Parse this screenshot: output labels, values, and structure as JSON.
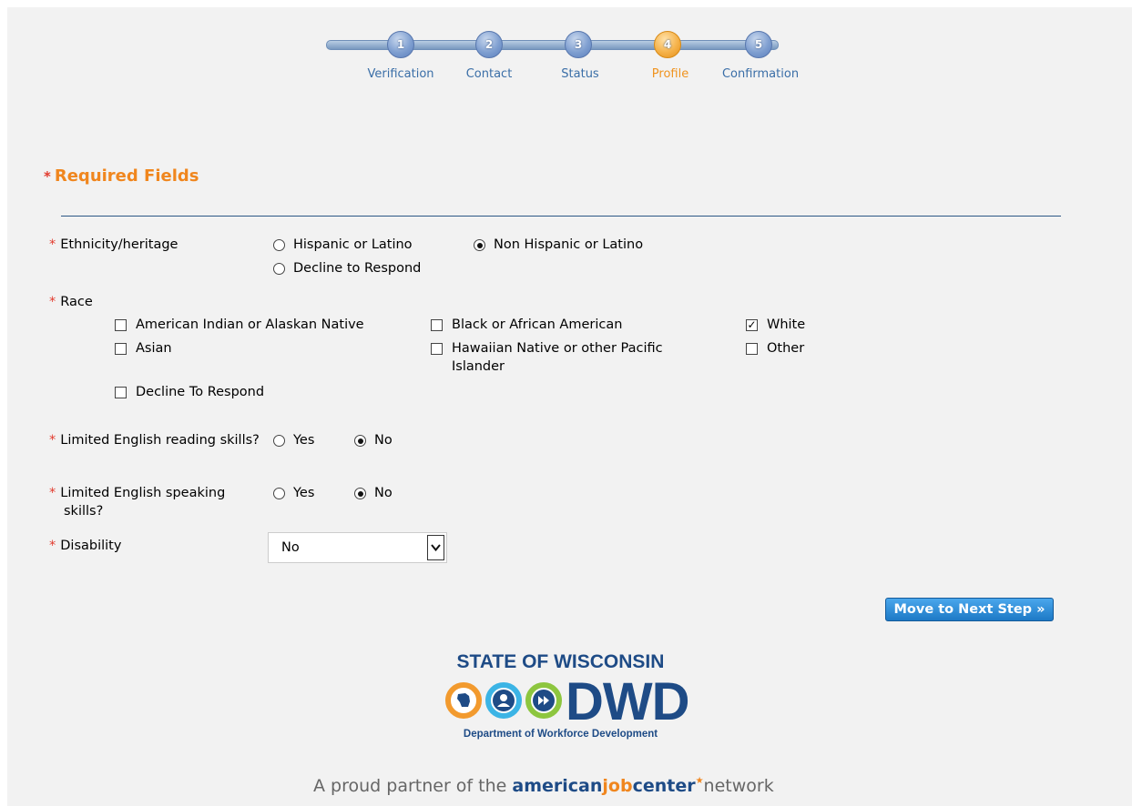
{
  "progress": {
    "steps": [
      {
        "number": "1",
        "label": "Verification"
      },
      {
        "number": "2",
        "label": "Contact"
      },
      {
        "number": "3",
        "label": "Status"
      },
      {
        "number": "4",
        "label": "Profile",
        "active": true
      },
      {
        "number": "5",
        "label": "Confirmation"
      }
    ]
  },
  "form": {
    "required_title": "Required Fields",
    "required_star": "*",
    "ethnicity": {
      "label": "Ethnicity/heritage",
      "options": [
        "Hispanic or Latino",
        "Non Hispanic or Latino",
        "Decline to Respond"
      ],
      "selected": "Non Hispanic or Latino"
    },
    "race": {
      "label": "Race",
      "options": [
        "American Indian or Alaskan Native",
        "Black or African American",
        "White",
        "Asian",
        "Hawaiian Native or other Pacific Islander",
        "Other",
        "Decline To Respond"
      ],
      "checked": [
        "White"
      ]
    },
    "reading": {
      "label": "Limited English reading skills?",
      "options": [
        "Yes",
        "No"
      ],
      "selected": "No"
    },
    "speaking": {
      "label": "Limited English speaking skills?",
      "options": [
        "Yes",
        "No"
      ],
      "selected": "No"
    },
    "disability": {
      "label": "Disability",
      "value": "No"
    },
    "next_button": "Move to Next Step »"
  },
  "footer": {
    "logo_top": "STATE OF WISCONSIN",
    "logo_main": "DWD",
    "logo_sub": "Department of Workforce Development",
    "partner_prefix": "A proud partner of the ",
    "partner_american": "american",
    "partner_job": "job",
    "partner_center": "center",
    "partner_suffix": "network"
  },
  "colors": {
    "accent_orange": "#f0861e",
    "step_blue": "#7f9fd0",
    "brand_blue": "#1e4b86",
    "required_red": "#e23b2e"
  }
}
